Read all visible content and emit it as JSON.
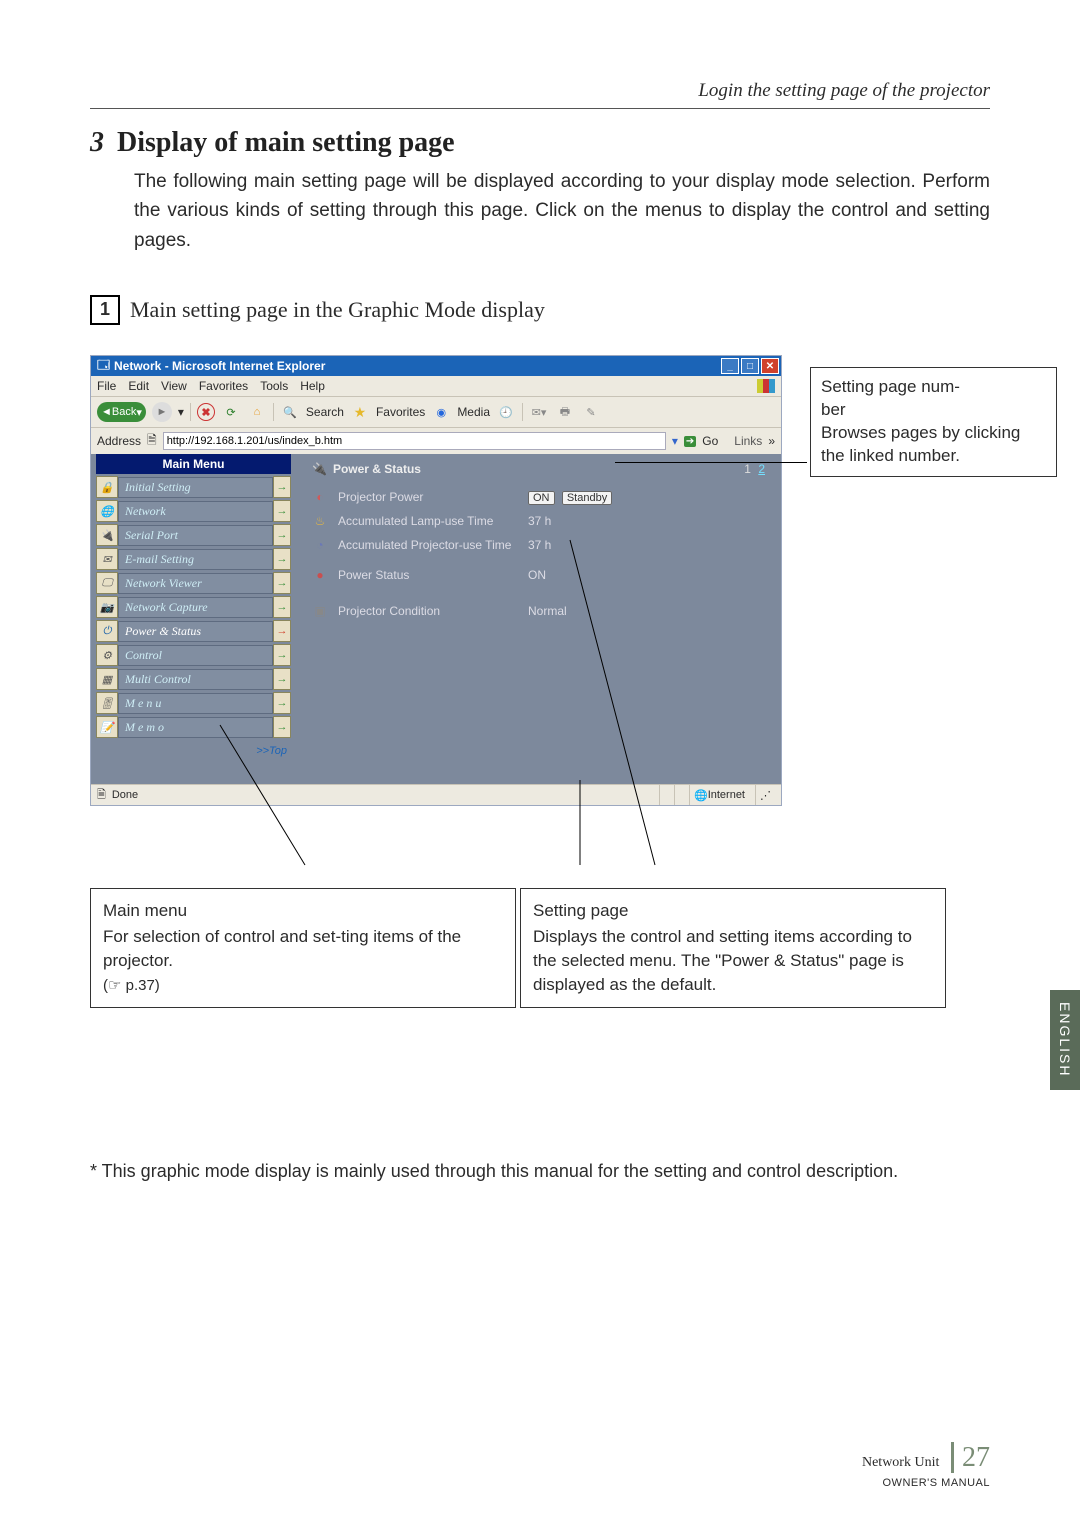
{
  "header": {
    "caption": "Login the setting page of the projector"
  },
  "section": {
    "step_num": "3",
    "title_rest": " Display of main setting page",
    "intro": "The following main setting page will be displayed according to your display mode selection. Perform the various kinds of setting through this page. Click on the menus to display the control and setting pages."
  },
  "sub": {
    "boxnum": "1",
    "title": " Main setting page in the Graphic Mode display"
  },
  "browser": {
    "title": "Network - Microsoft Internet Explorer",
    "menus": [
      "File",
      "Edit",
      "View",
      "Favorites",
      "Tools",
      "Help"
    ],
    "toolbar": {
      "back": "Back",
      "search": "Search",
      "favorites": "Favorites",
      "media": "Media"
    },
    "address_label": "Address",
    "url": "http://192.168.1.201/us/index_b.htm",
    "go": "Go",
    "links": "Links",
    "status_done": "Done",
    "status_zone": "Internet"
  },
  "mainmenu": {
    "title": "Main Menu",
    "items": [
      {
        "label": "Initial Setting"
      },
      {
        "label": "Network"
      },
      {
        "label": "Serial Port"
      },
      {
        "label": "E-mail Setting"
      },
      {
        "label": "Network Viewer"
      },
      {
        "label": "Network Capture"
      },
      {
        "label": "Power & Status"
      },
      {
        "label": "Control"
      },
      {
        "label": "Multi Control"
      },
      {
        "label": "M e n u"
      },
      {
        "label": "M e m o"
      }
    ],
    "toplink": ">>Top"
  },
  "panel": {
    "title": "Power & Status",
    "page_current": "1",
    "page_other": "2",
    "rows": [
      {
        "label": "Projector Power",
        "val1": "ON",
        "val2": "Standby",
        "icon_color": "#d05a5a"
      },
      {
        "label": "Accumulated Lamp-use Time",
        "val": "37 h",
        "icon_color": "#e2b544"
      },
      {
        "label": "Accumulated Projector-use Time",
        "val": "37 h",
        "icon_color": "#6b78b6"
      },
      {
        "label": "Power Status",
        "val": "ON",
        "icon_color": "#c94f4f"
      },
      {
        "label": "Projector Condition",
        "val": "Normal",
        "icon_color": "#888"
      }
    ]
  },
  "annotations": {
    "side": {
      "l1": "Setting page num-",
      "l2": "ber",
      "l3": "Browses pages by clicking the linked number."
    },
    "left_box": {
      "title": "Main menu",
      "body": "For selection of  control and set-ting items of the projector.",
      "ref": "(☞ p.37)"
    },
    "right_box": {
      "title": "Setting page",
      "body": "Displays the control and setting items according to the selected menu. The \"Power & Status\" page is displayed as the default."
    }
  },
  "side_tab": "ENGLISH",
  "footnote": "* This graphic mode display is mainly used through this manual for the setting and control description.",
  "footer": {
    "line1": "Network Unit",
    "line2": "OWNER'S MANUAL",
    "page": "27"
  }
}
